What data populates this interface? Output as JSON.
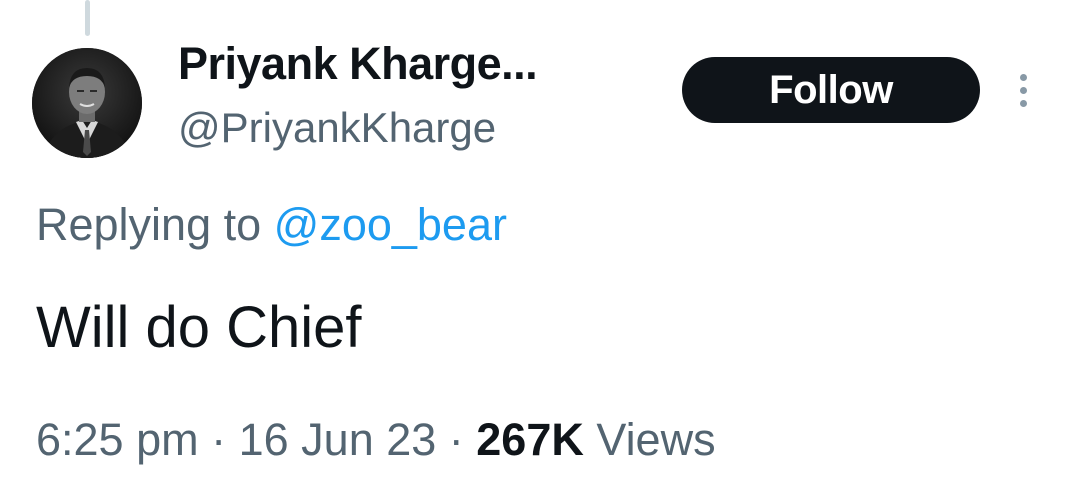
{
  "tweet": {
    "author": {
      "display_name": "Priyank Kharge...",
      "handle": "@PriyankKharge",
      "avatar_icon": "profile-photo"
    },
    "follow_label": "Follow",
    "more_icon": "vertical-ellipsis-icon",
    "reply": {
      "prefix": "Replying to ",
      "mention": "@zoo_bear"
    },
    "text": "Will do Chief",
    "time": "6:25 pm",
    "separator": " · ",
    "date": "16 Jun 23",
    "views_count": "267K",
    "views_label": " Views"
  },
  "colors": {
    "text_primary": "#0f1419",
    "text_secondary": "#536471",
    "link": "#1d9bf0",
    "button_bg": "#0f1419",
    "thread_line": "#cfd9de"
  }
}
